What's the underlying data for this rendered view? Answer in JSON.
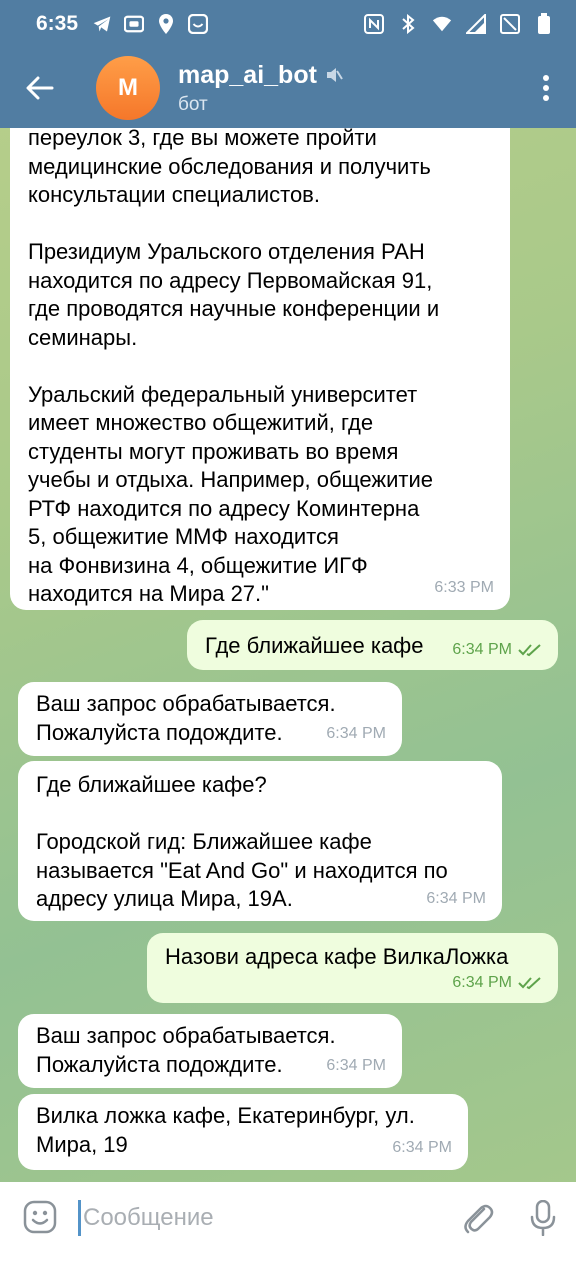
{
  "status_bar": {
    "time": "6:35",
    "left_icons": [
      "telegram-icon",
      "screen-share-icon",
      "location-pin-icon",
      "smile-square-icon"
    ],
    "right_icons": [
      "nfc-icon",
      "bluetooth-icon",
      "wifi-icon",
      "signal-icon",
      "battery-icon"
    ]
  },
  "header": {
    "avatar_letter": "M",
    "title": "map_ai_bot",
    "subtitle": "бот",
    "muted_icon": "muted-speaker-icon",
    "colors": {
      "bar": "#517da2",
      "avatar": "#f5772a"
    }
  },
  "messages": [
    {
      "direction": "incoming",
      "text": "переулок 3, где вы можете пройти\nмедицинские обследования и получить\nконсультации специалистов.\n\nПрезидиум Уральского отделения РАН\nнаходится по адресу Первомайская 91,\nгде проводятся научные конференции и\nсеминары.\n\nУральский федеральный университет\nимеет множество общежитий, где\nстуденты могут проживать во время\nучебы и отдыха. Например, общежитие\nРТФ находится по адресу Коминтерна\n5, общежитие ММФ находится\nна Фонвизина 4, общежитие ИГФ\nнаходится на Мира 27.\"",
      "time": "6:33 PM"
    },
    {
      "direction": "outgoing",
      "text": "Где ближайшее кафе",
      "time": "6:34 PM",
      "read": true
    },
    {
      "direction": "incoming",
      "text": "Ваш запрос обрабатывается.\nПожалуйста подождите.",
      "time": "6:34 PM"
    },
    {
      "direction": "incoming",
      "text": "Где ближайшее кафе?\n\nГородской гид: Ближайшее кафе\nназывается \"Eat And Go\" и находится по\nадресу улица Мира, 19А.",
      "time": "6:34 PM"
    },
    {
      "direction": "outgoing",
      "text": "Назови адреса кафе ВилкаЛожка",
      "time": "6:34 PM",
      "read": true
    },
    {
      "direction": "incoming",
      "text": "Ваш запрос обрабатывается.\nПожалуйста подождите.",
      "time": "6:34 PM"
    },
    {
      "direction": "incoming",
      "text": "Вилка ложка кафе, Екатеринбург, ул.\nМира, 19",
      "time": "6:34 PM"
    }
  ],
  "composer": {
    "placeholder": "Сообщение",
    "value": "",
    "icons": [
      "emoji-icon",
      "paperclip-icon",
      "microphone-icon"
    ]
  }
}
